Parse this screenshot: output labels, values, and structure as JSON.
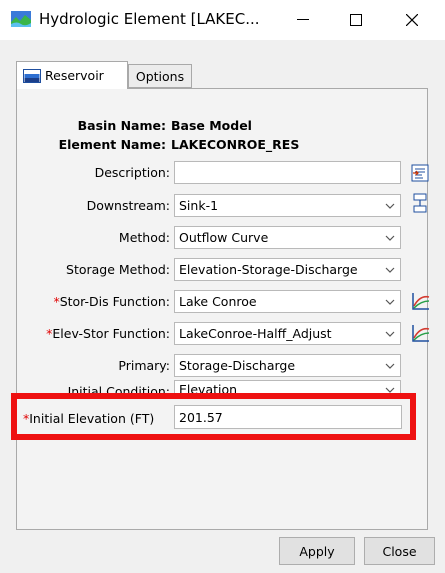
{
  "window": {
    "title": "Hydrologic Element [LAKEC...",
    "minimize_icon": "minimize-icon",
    "maximize_icon": "maximize-icon",
    "close_icon": "close-icon"
  },
  "tabs": [
    {
      "label": "Reservoir",
      "icon": "reservoir-icon",
      "active": true
    },
    {
      "label": "Options",
      "active": false
    }
  ],
  "info": {
    "basin_label": "Basin Name:",
    "basin_value": "Base Model",
    "element_label": "Element Name:",
    "element_value": "LAKECONROE_RES"
  },
  "form": {
    "description": {
      "label": "Description:",
      "value": ""
    },
    "downstream": {
      "label": "Downstream:",
      "value": "Sink-1"
    },
    "method": {
      "label": "Method:",
      "value": "Outflow Curve"
    },
    "storage_method": {
      "label": "Storage Method:",
      "value": "Elevation-Storage-Discharge"
    },
    "stor_dis_function": {
      "required": "*",
      "label": "Stor-Dis Function:",
      "value": "Lake Conroe"
    },
    "elev_stor_function": {
      "required": "*",
      "label": "Elev-Stor Function:",
      "value": "LakeConroe-Halff_Adjust"
    },
    "primary": {
      "label": "Primary:",
      "value": "Storage-Discharge"
    },
    "initial_condition": {
      "label": "Initial Condition:",
      "value": "Elevation"
    },
    "initial_elevation": {
      "required": "*",
      "label": "Initial Elevation (FT)",
      "value": "201.57"
    }
  },
  "highlight_color": "#ee1111",
  "buttons": {
    "apply": "Apply",
    "close": "Close"
  }
}
